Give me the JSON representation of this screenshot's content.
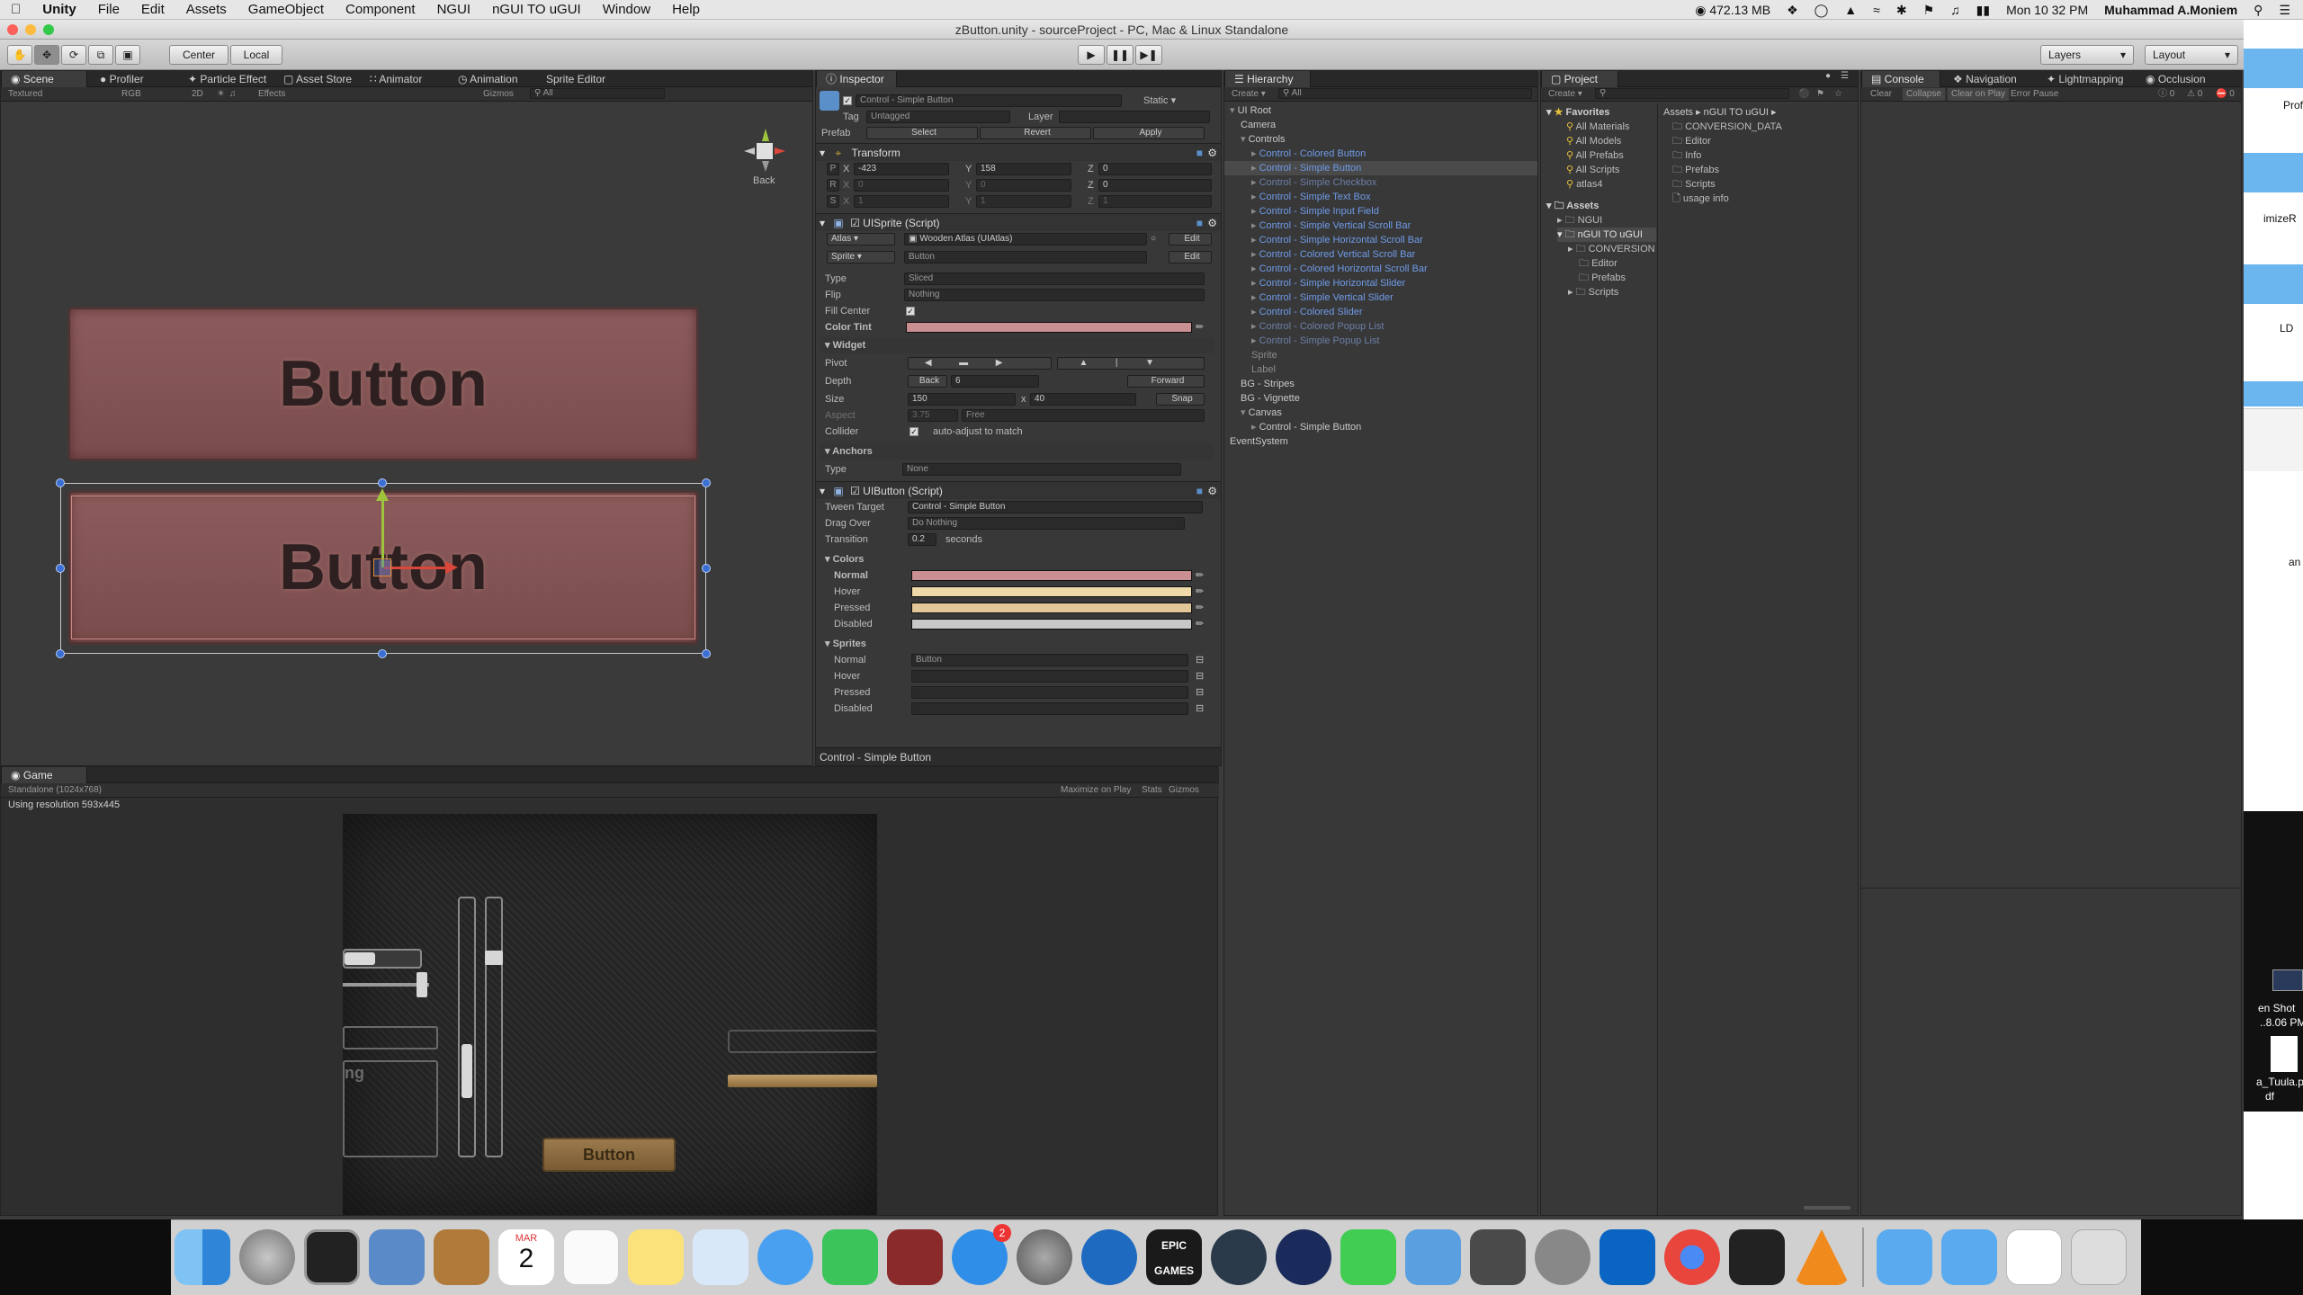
{
  "menubar": {
    "app": "Unity",
    "items": [
      "File",
      "Edit",
      "Assets",
      "GameObject",
      "Component",
      "NGUI",
      "nGUI TO uGUI",
      "Window",
      "Help"
    ],
    "memory": "472.13 MB",
    "clock": "Mon 10 32 PM",
    "user": "Muhammad A.Moniem"
  },
  "window": {
    "title": "zButton.unity - sourceProject - PC, Mac & Linux Standalone"
  },
  "toolbar": {
    "center": "Center",
    "local": "Local",
    "layers": "Layers",
    "layout": "Layout"
  },
  "scene": {
    "tabs": [
      "Scene",
      "Profiler",
      "Particle Effect",
      "Asset Store",
      "Animator",
      "Animation",
      "Sprite Editor"
    ],
    "shading": "Textured",
    "rgb": "RGB",
    "mode2d": "2D",
    "effects": "Effects",
    "gizmos": "Gizmos",
    "search": "All",
    "back": "Back",
    "button_label": "Button"
  },
  "game": {
    "tab": "Game",
    "resolution": "Standalone (1024x768)",
    "maximize": "Maximize on Play",
    "stats": "Stats",
    "gizmos": "Gizmos",
    "using_res": "Using resolution 593x445",
    "button_label": "Button",
    "partial_label": "ng"
  },
  "inspector": {
    "tab": "Inspector",
    "object_name": "Control - Simple Button",
    "static": "Static",
    "tag_label": "Tag",
    "tag_value": "Untagged",
    "layer_label": "Layer",
    "prefab_label": "Prefab",
    "prefab_select": "Select",
    "prefab_revert": "Revert",
    "prefab_apply": "Apply",
    "transform": {
      "title": "Transform",
      "p": "P",
      "r": "R",
      "s": "S",
      "px": "-423",
      "py": "158",
      "pz": "0",
      "rx": "0",
      "ry": "0",
      "rz": "0",
      "sx": "1",
      "sy": "1",
      "sz": "1",
      "x": "X",
      "y": "Y",
      "z": "Z"
    },
    "uisprite": {
      "title": "UISprite (Script)",
      "atlas": "Atlas",
      "atlas_value": "Wooden Atlas (UIAtlas)",
      "edit": "Edit",
      "sprite": "Sprite",
      "sprite_value": "Button",
      "type": "Type",
      "type_value": "Sliced",
      "flip": "Flip",
      "flip_value": "Nothing",
      "fill_center": "Fill Center",
      "color_tint": "Color Tint"
    },
    "widget": {
      "title": "Widget",
      "pivot": "Pivot",
      "depth": "Depth",
      "depth_back": "Back",
      "depth_value": "6",
      "depth_forward": "Forward",
      "size": "Size",
      "size_w": "150",
      "size_x": "x",
      "size_h": "40",
      "snap": "Snap",
      "aspect": "Aspect",
      "aspect_value": "3.75",
      "aspect_mode": "Free",
      "collider": "Collider",
      "collider_text": "auto-adjust to match"
    },
    "anchors": {
      "title": "Anchors",
      "type": "Type",
      "type_value": "None"
    },
    "uibutton": {
      "title": "UIButton (Script)",
      "tween_target": "Tween Target",
      "tween_value": "Control - Simple Button",
      "drag_over": "Drag Over",
      "drag_value": "Do Nothing",
      "transition": "Transition",
      "transition_value": "0.2",
      "seconds": "seconds",
      "colors_title": "Colors",
      "normal": "Normal",
      "hover": "Hover",
      "pressed": "Pressed",
      "disabled": "Disabled",
      "sprites_title": "Sprites",
      "sprite_normal_value": "Button"
    },
    "footer": "Control - Simple Button"
  },
  "hierarchy": {
    "tab": "Hierarchy",
    "create": "Create",
    "search": "All",
    "items": [
      {
        "label": "UI Root",
        "indent": 0,
        "cls": ""
      },
      {
        "label": "Camera",
        "indent": 1,
        "cls": ""
      },
      {
        "label": "Controls",
        "indent": 1,
        "cls": ""
      },
      {
        "label": "Control - Colored Button",
        "indent": 2,
        "cls": "blue"
      },
      {
        "label": "Control - Simple Button",
        "indent": 2,
        "cls": "blue sel"
      },
      {
        "label": "Control - Simple Checkbox",
        "indent": 2,
        "cls": "dim"
      },
      {
        "label": "Control - Simple Text Box",
        "indent": 2,
        "cls": "blue"
      },
      {
        "label": "Control - Simple Input Field",
        "indent": 2,
        "cls": "blue"
      },
      {
        "label": "Control - Simple Vertical Scroll Bar",
        "indent": 2,
        "cls": "blue"
      },
      {
        "label": "Control - Simple Horizontal Scroll Bar",
        "indent": 2,
        "cls": "blue"
      },
      {
        "label": "Control - Colored Vertical Scroll Bar",
        "indent": 2,
        "cls": "blue"
      },
      {
        "label": "Control - Colored Horizontal Scroll Bar",
        "indent": 2,
        "cls": "blue"
      },
      {
        "label": "Control - Simple Horizontal Slider",
        "indent": 2,
        "cls": "blue"
      },
      {
        "label": "Control - Simple Vertical Slider",
        "indent": 2,
        "cls": "blue"
      },
      {
        "label": "Control - Colored Slider",
        "indent": 2,
        "cls": "blue"
      },
      {
        "label": "Control - Colored Popup List",
        "indent": 2,
        "cls": "dim"
      },
      {
        "label": "Control - Simple Popup List",
        "indent": 2,
        "cls": "dim"
      },
      {
        "label": "Sprite",
        "indent": 2,
        "cls": "grey"
      },
      {
        "label": "Label",
        "indent": 2,
        "cls": "grey"
      },
      {
        "label": "BG - Stripes",
        "indent": 1,
        "cls": ""
      },
      {
        "label": "BG - Vignette",
        "indent": 1,
        "cls": ""
      },
      {
        "label": "Canvas",
        "indent": 1,
        "cls": ""
      },
      {
        "label": "Control - Simple Button",
        "indent": 2,
        "cls": ""
      },
      {
        "label": "EventSystem",
        "indent": 0,
        "cls": ""
      }
    ]
  },
  "project": {
    "tab": "Project",
    "create": "Create",
    "breadcrumb": "Assets ▸ nGUI TO uGUI ▸",
    "favorites": "Favorites",
    "fav_items": [
      "All Materials",
      "All Models",
      "All Prefabs",
      "All Scripts",
      "atlas4"
    ],
    "assets": "Assets",
    "tree": [
      "NGUI",
      "nGUI TO uGUI",
      "CONVERSION",
      "Editor",
      "Prefabs",
      "Scripts"
    ],
    "files": [
      "CONVERSION_DATA",
      "Editor",
      "Info",
      "Prefabs",
      "Scripts",
      "usage info"
    ]
  },
  "console": {
    "tabs": [
      "Console",
      "Navigation",
      "Lightmapping",
      "Occlusion"
    ],
    "buttons": [
      "Clear",
      "Collapse",
      "Clear on Play",
      "Error Pause"
    ],
    "counts": [
      "0",
      "0",
      "0"
    ]
  },
  "desktop": {
    "labels": [
      "Profiler",
      "imizeR",
      "LD",
      "an",
      "en Shot",
      "..8.06 PM",
      "a_Tuula.p",
      "df"
    ]
  },
  "dock": {
    "badge": "2",
    "calendar_month": "MAR",
    "calendar_day": "2",
    "epic_text": "EPIC GAMES"
  }
}
